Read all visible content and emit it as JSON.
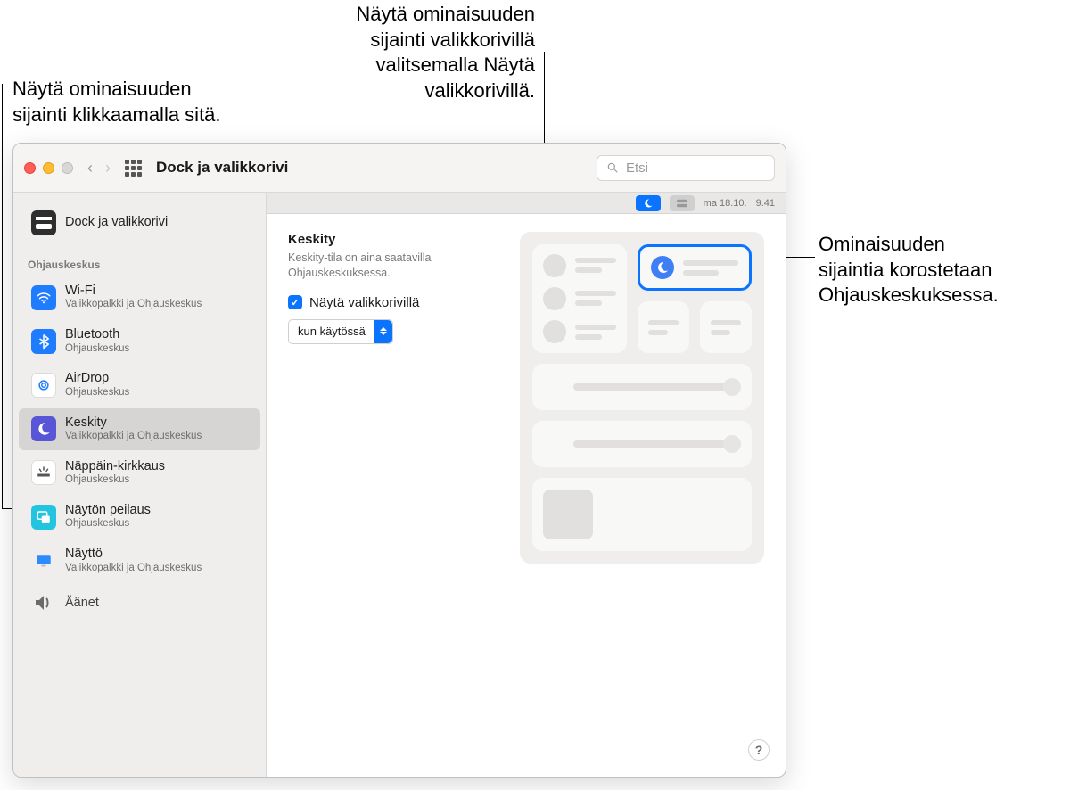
{
  "callouts": {
    "left": "Näytä ominaisuuden\nsijainti klikkaamalla sitä.",
    "top": "Näytä ominaisuuden\nsijainti valikkorivillä\nvalitsemalla Näytä\nvalikkorivillä.",
    "right": "Ominaisuuden\nsijaintia korostetaan\nOhjauskeskuksessa."
  },
  "window_title": "Dock ja valikkorivi",
  "search_placeholder": "Etsi",
  "menubar_date": "ma 18.10.",
  "menubar_time": "9.41",
  "sidebar": {
    "top_item": {
      "label": "Dock ja valikkorivi"
    },
    "section_label": "Ohjauskeskus",
    "items": [
      {
        "label": "Wi-Fi",
        "sub": "Valikkopalkki ja Ohjauskeskus"
      },
      {
        "label": "Bluetooth",
        "sub": "Ohjauskeskus"
      },
      {
        "label": "AirDrop",
        "sub": "Ohjauskeskus"
      },
      {
        "label": "Keskity",
        "sub": "Valikkopalkki ja Ohjauskeskus"
      },
      {
        "label": "Näppäin-kirkkaus",
        "sub": "Ohjauskeskus"
      },
      {
        "label": "Näytön peilaus",
        "sub": "Ohjauskeskus"
      },
      {
        "label": "Näyttö",
        "sub": "Valikkopalkki ja Ohjauskeskus"
      },
      {
        "label": "Äänet",
        "sub": ""
      }
    ]
  },
  "pane": {
    "title": "Keskity",
    "description": "Keskity-tila on aina saatavilla Ohjauskeskuksessa.",
    "checkbox_label": "Näytä valikkorivillä",
    "dropdown_value": "kun käytössä"
  }
}
